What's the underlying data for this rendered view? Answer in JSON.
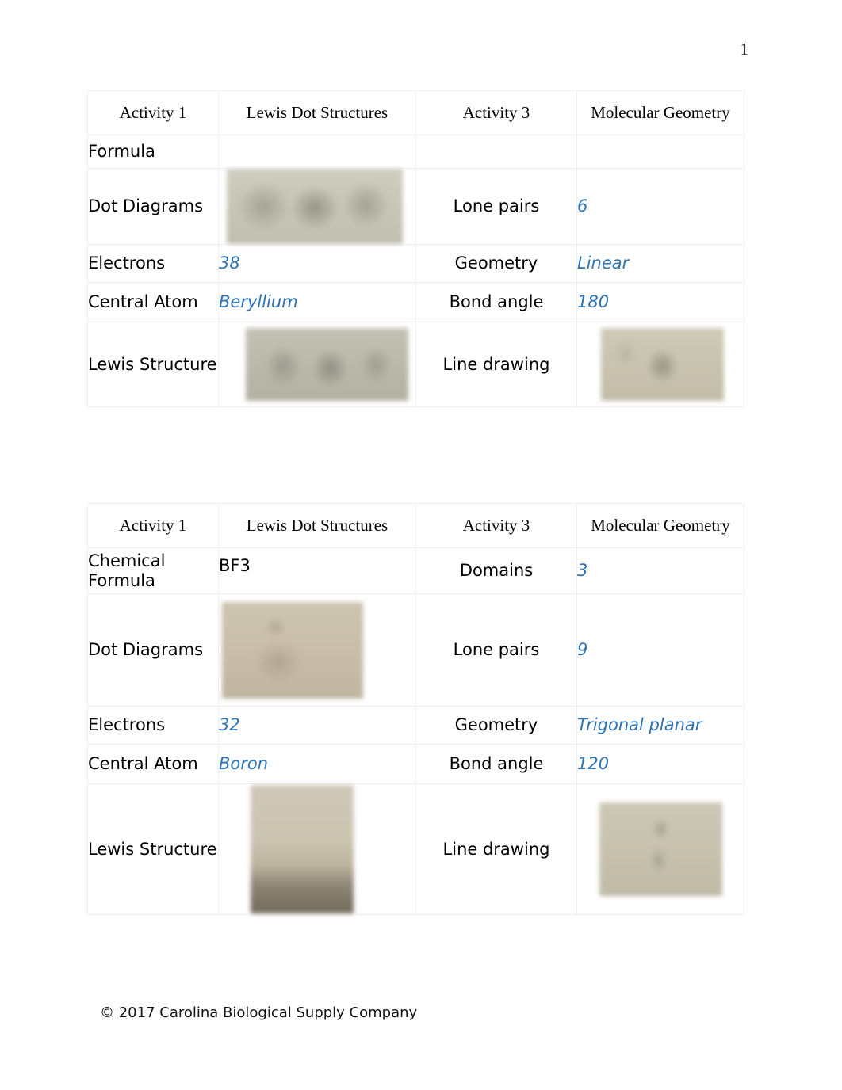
{
  "document": {
    "page_number": "1",
    "footer": "© 2017 Carolina Biological Supply Company"
  },
  "tables": [
    {
      "header": {
        "col_a": "Activity 1",
        "col_b": "Lewis Dot Structures",
        "col_c": "Activity 3",
        "col_d": "Molecular Geometry"
      },
      "rows": [
        {
          "left_label": "Formula",
          "left_value": "",
          "right_label": "",
          "right_value": ""
        },
        {
          "left_label": "Dot Diagrams",
          "left_value": "dot-diagram-photo",
          "right_label": "Lone pairs",
          "right_value": "6"
        },
        {
          "left_label": "Electrons",
          "left_value": "38",
          "right_label": "Geometry",
          "right_value": "Linear"
        },
        {
          "left_label": "Central Atom",
          "left_value": "Beryllium",
          "right_label": "Bond angle",
          "right_value": "180"
        },
        {
          "left_label": "Lewis Structure",
          "left_value": "lewis-structure-photo",
          "right_label": "Line drawing",
          "right_value": "line-drawing-photo"
        }
      ]
    },
    {
      "header": {
        "col_a": "Activity 1",
        "col_b": "Lewis Dot Structures",
        "col_c": "Activity 3",
        "col_d": "Molecular Geometry"
      },
      "rows": [
        {
          "left_label": "Chemical Formula",
          "left_value": "BF3",
          "right_label": "Domains",
          "right_value": "3"
        },
        {
          "left_label": "Dot Diagrams",
          "left_value": "dot-diagram-photo",
          "right_label": "Lone pairs",
          "right_value": "9"
        },
        {
          "left_label": "Electrons",
          "left_value": "32",
          "right_label": "Geometry",
          "right_value": "Trigonal planar"
        },
        {
          "left_label": "Central Atom",
          "left_value": "Boron",
          "right_label": "Bond angle",
          "right_value": "120"
        },
        {
          "left_label": "Lewis Structure",
          "left_value": "lewis-structure-photo",
          "right_label": "Line drawing",
          "right_value": "line-drawing-photo"
        }
      ]
    }
  ],
  "colors": {
    "answer_blue": "#2e74b5",
    "text_black": "#000000",
    "border_gray": "#f0f0f0"
  }
}
